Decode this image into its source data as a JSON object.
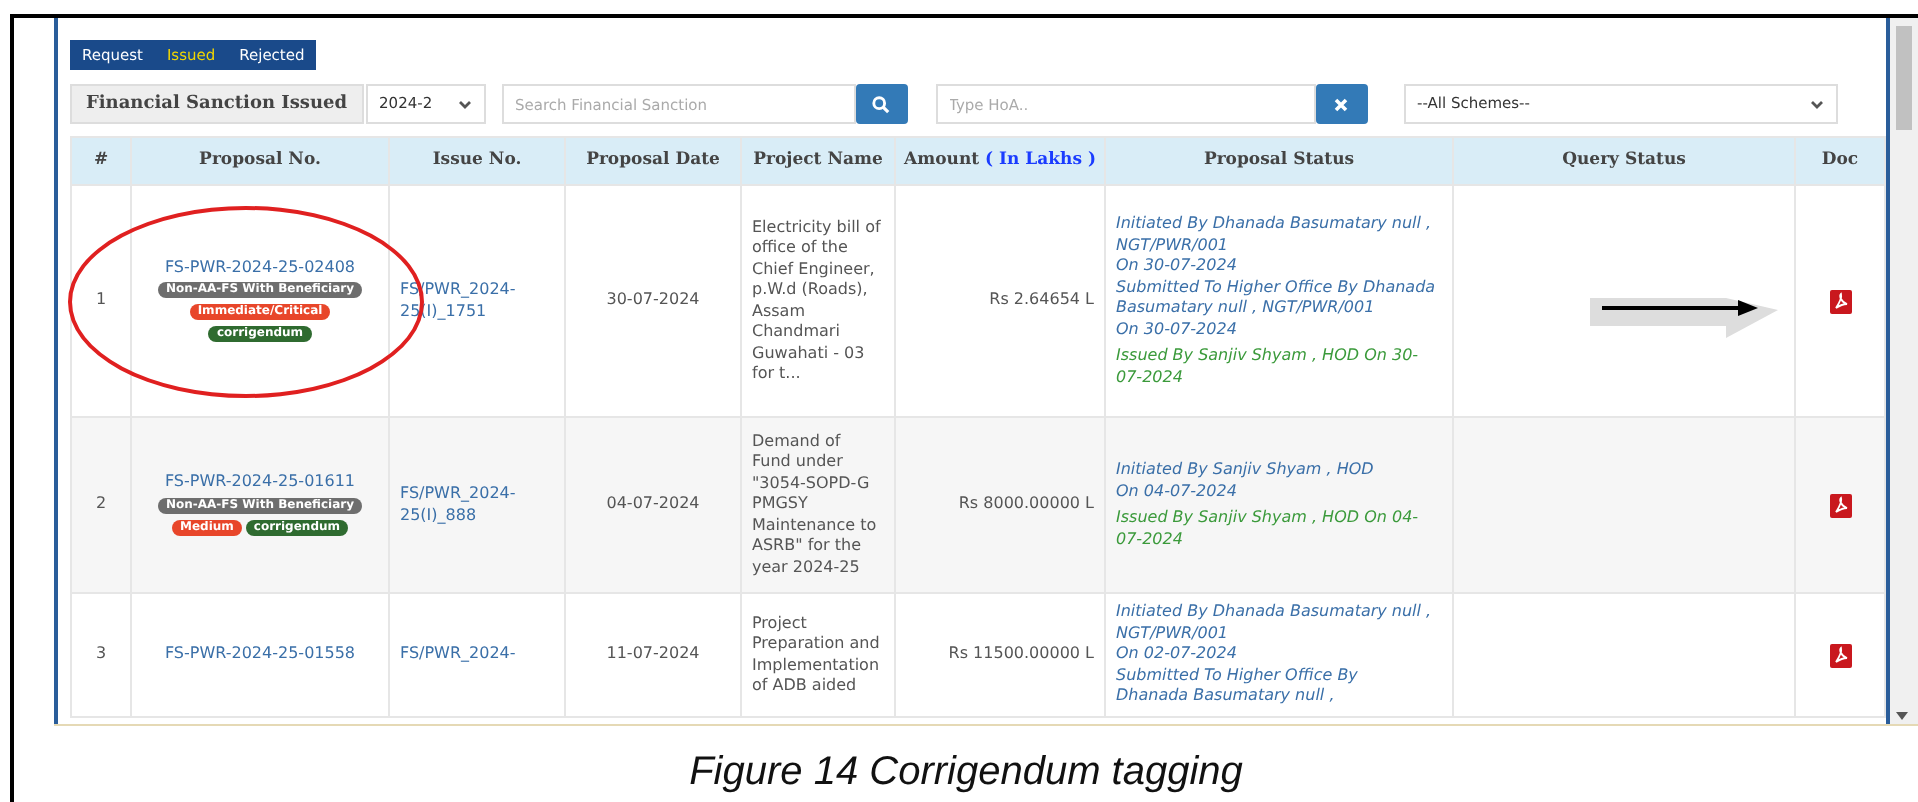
{
  "tabs": [
    {
      "label": "Request",
      "selected": false
    },
    {
      "label": "Issued",
      "selected": true
    },
    {
      "label": "Rejected",
      "selected": false
    }
  ],
  "toolbar": {
    "title": "Financial Sanction Issued",
    "year": "2024-2",
    "search": {
      "placeholder": "Search Financial Sanction"
    },
    "hoa": {
      "placeholder": "Type HoA.."
    },
    "scheme": "--All Schemes--"
  },
  "table": {
    "columns": [
      {
        "label": "#"
      },
      {
        "label": "Proposal No."
      },
      {
        "label": "Issue No."
      },
      {
        "label": "Proposal Date"
      },
      {
        "label": "Project Name"
      },
      {
        "label": "Amount",
        "note": "( In Lakhs )"
      },
      {
        "label": "Proposal Status"
      },
      {
        "label": "Query Status"
      },
      {
        "label": "Doc"
      }
    ],
    "rows": [
      {
        "index": "1",
        "proposal": "FS-PWR-2024-25-02408",
        "tags": [
          {
            "text": "Non-AA-FS With Beneficiary",
            "color": "#6e6e6e"
          },
          {
            "text": "Immediate/Critical",
            "color": "#e8462a"
          },
          {
            "text": "corrigendum",
            "color": "#2f6b30"
          }
        ],
        "issue": "FS/PWR_2024-25(I)_1751",
        "date": "30-07-2024",
        "project": "Electricity bill of office of the Chief Engineer, p.W.d (Roads), Assam Chandmari Guwahati - 03 for t...",
        "amount": "Rs 2.64654 L",
        "status": [
          {
            "kind": "step",
            "text": "Initiated By Dhanada Basumatary null , NGT/PWR/001"
          },
          {
            "kind": "step",
            "text": "On 30-07-2024"
          },
          {
            "kind": "step",
            "text": "Submitted To Higher Office By Dhanada Basumatary null , NGT/PWR/001"
          },
          {
            "kind": "step",
            "text": "On 30-07-2024"
          },
          {
            "kind": "issued",
            "text": "Issued By Sanjiv Shyam , HOD On 30-07-2024"
          }
        ],
        "annotated": true
      },
      {
        "index": "2",
        "proposal": "FS-PWR-2024-25-01611",
        "tags": [
          {
            "text": "Non-AA-FS With Beneficiary",
            "color": "#6e6e6e"
          },
          {
            "text": "Medium",
            "color": "#e8462a"
          },
          {
            "text": "corrigendum",
            "color": "#2f6b30"
          }
        ],
        "issue": "FS/PWR_2024-25(I)_888",
        "date": "04-07-2024",
        "project": "Demand of Fund under \"3054-SOPD-G PMGSY Maintenance to ASRB\" for the year 2024-25",
        "amount": "Rs 8000.00000 L",
        "status": [
          {
            "kind": "step",
            "text": "Initiated By Sanjiv Shyam , HOD"
          },
          {
            "kind": "step",
            "text": "On 04-07-2024"
          },
          {
            "kind": "issued",
            "text": "Issued By Sanjiv Shyam , HOD On 04-07-2024"
          }
        ],
        "annotated": false
      },
      {
        "index": "3",
        "proposal": "FS-PWR-2024-25-01558",
        "tags": [],
        "issue": "FS/PWR_2024-",
        "date": "11-07-2024",
        "project": "Project Preparation and Implementation of ADB aided",
        "amount": "Rs 11500.00000 L",
        "status": [
          {
            "kind": "step",
            "text": "Initiated By Dhanada Basumatary null , NGT/PWR/001"
          },
          {
            "kind": "step",
            "text": "On 02-07-2024"
          },
          {
            "kind": "step",
            "text": "Submitted To Higher Office By"
          },
          {
            "kind": "step",
            "text": "Dhanada Basumatary null ,"
          }
        ],
        "annotated": false
      }
    ]
  },
  "caption": "Figure 14 Corrigendum tagging"
}
